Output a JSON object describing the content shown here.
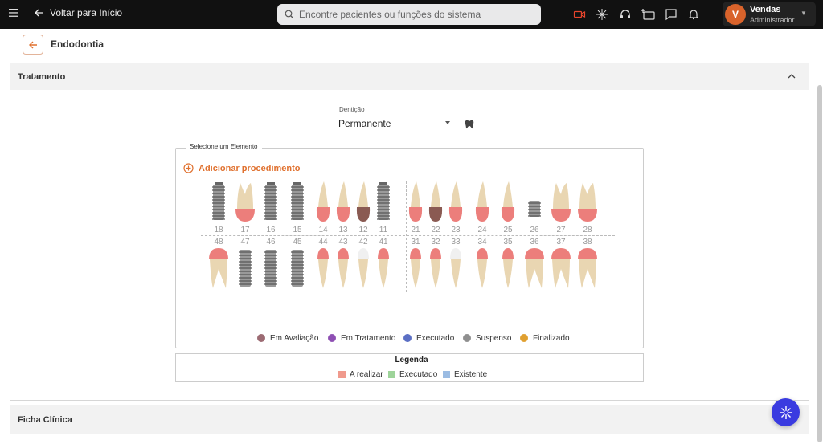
{
  "topbar": {
    "back_label": "Voltar para Início",
    "search_placeholder": "Encontre pacientes ou funções do sistema",
    "icons": [
      "video-icon",
      "sparkle-icon",
      "headset-icon",
      "screen-share-icon",
      "chat-icon",
      "bell-icon"
    ],
    "user": {
      "initial": "V",
      "name": "Vendas",
      "role": "Administrador"
    }
  },
  "page": {
    "title": "Endodontia"
  },
  "sections": {
    "treatment": "Tratamento",
    "clinical": "Ficha Clínica"
  },
  "dentition": {
    "label": "Dentição",
    "value": "Permanente"
  },
  "chart": {
    "fieldset_label": "Selecione um Elemento",
    "add_procedure": "Adicionar procedimento",
    "upper_teeth": [
      "18",
      "17",
      "16",
      "15",
      "14",
      "13",
      "12",
      "11",
      "21",
      "22",
      "23",
      "24",
      "25",
      "26",
      "27",
      "28"
    ],
    "lower_teeth": [
      "48",
      "47",
      "46",
      "45",
      "44",
      "43",
      "42",
      "41",
      "31",
      "32",
      "33",
      "34",
      "35",
      "36",
      "37",
      "38"
    ]
  },
  "statuses": [
    {
      "label": "Em Avaliação",
      "color": "#9c6b73"
    },
    {
      "label": "Em Tratamento",
      "color": "#8e4fb3"
    },
    {
      "label": "Executado",
      "color": "#5b6fc4"
    },
    {
      "label": "Suspenso",
      "color": "#8f8f8f"
    },
    {
      "label": "Finalizado",
      "color": "#e0a030"
    }
  ],
  "legend": {
    "title": "Legenda",
    "items": [
      {
        "label": "A realizar",
        "color": "#f09a8d"
      },
      {
        "label": "Executado",
        "color": "#9ed49a"
      },
      {
        "label": "Existente",
        "color": "#9bbce3"
      }
    ]
  }
}
